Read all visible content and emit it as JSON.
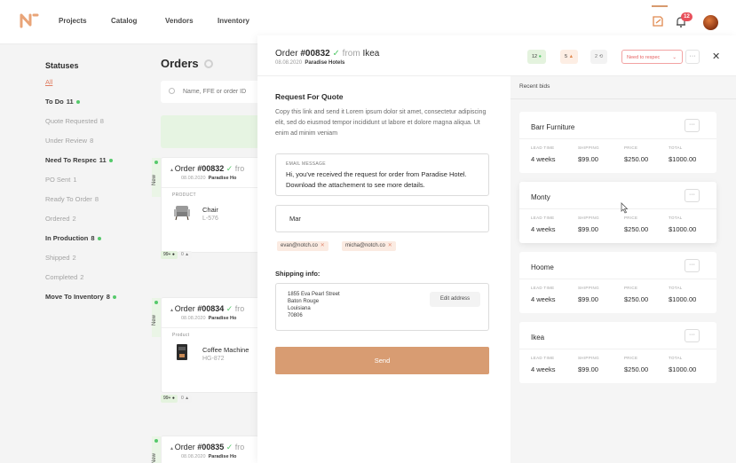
{
  "nav": {
    "items": [
      "Projects",
      "Catalog",
      "Vendors",
      "Inventory"
    ],
    "notification_count": "12"
  },
  "sidebar": {
    "title": "Statuses",
    "all_label": "All",
    "items": [
      {
        "label": "To Do",
        "count": "11",
        "style": "dark",
        "dot": true
      },
      {
        "label": "Quote Requested",
        "count": "8",
        "style": "muted",
        "dot": false
      },
      {
        "label": "Under Review",
        "count": "8",
        "style": "muted",
        "dot": false
      },
      {
        "label": "Need To Respec",
        "count": "11",
        "style": "dark",
        "dot": true
      },
      {
        "label": "PO Sent",
        "count": "1",
        "style": "muted",
        "dot": false
      },
      {
        "label": "Ready To Order",
        "count": "8",
        "style": "muted",
        "dot": false
      },
      {
        "label": "Ordered",
        "count": "2",
        "style": "muted",
        "dot": false
      },
      {
        "label": "In Production",
        "count": "8",
        "style": "dark",
        "dot": true
      },
      {
        "label": "Shipped",
        "count": "2",
        "style": "muted",
        "dot": false
      },
      {
        "label": "Completed",
        "count": "2",
        "style": "muted",
        "dot": false
      },
      {
        "label": "Move To Inventory",
        "count": "8",
        "style": "dark",
        "dot": true
      }
    ]
  },
  "orders": {
    "title": "Orders",
    "search_placeholder": "Name, FFE or order ID",
    "cards": [
      {
        "prefix": "Order ",
        "number": "#00832",
        "from": " fro",
        "date": "08.08.2020",
        "hotel": "Paradise Ho",
        "label": "PRODUCT",
        "name": "Chair",
        "code": "L-576",
        "badge1": "99+",
        "badge2": "0"
      },
      {
        "prefix": "Order ",
        "number": "#00834",
        "from": " fro",
        "date": "08.08.2020",
        "hotel": "Paradise Ho",
        "label": "Product",
        "name": "Coffee Machine",
        "code": "HG-872",
        "badge1": "99+",
        "badge2": "0"
      },
      {
        "prefix": "Order ",
        "number": "#00835",
        "from": " fro",
        "date": "08.08.2020",
        "hotel": "Paradise Ho"
      }
    ],
    "new_label": "New"
  },
  "modal": {
    "title_prefix": "Order ",
    "number": "#00832",
    "from": " from ",
    "vendor": "Ikea",
    "date": "08.08.2020",
    "hotel": "Paradise Hotels",
    "chips": {
      "messages": "12",
      "orders": "5",
      "history": "2",
      "status": "Need to respec"
    },
    "rfq_title": "Request For Quote",
    "rfq_desc": "Copy this link and send it Lorem ipsum dolor sit amet, consectetur adipiscing elit, sed do eiusmod tempor incididunt ut labore et dolore magna aliqua. Ut enim ad minim veniam",
    "email_label": "EMAIL MESSAGE",
    "email_text": "Hi, you've received the request for order from Paradise Hotel. Download the attachement to see more details.",
    "to_value": "Mar",
    "recipients": [
      "evan@notch.co",
      "micha@notch.co"
    ],
    "shipping_title": "Shipping info:",
    "address": [
      "1855 Eva Pearl Street",
      "Baton Rouge",
      "Louisiana",
      "70806"
    ],
    "edit_address": "Edit address",
    "send": "Send"
  },
  "bids": {
    "title": "Recent bids",
    "columns": [
      "LEAD TIME",
      "SHIPPING",
      "PRICE",
      "TOTAL"
    ],
    "items": [
      {
        "vendor": "Barr Furniture",
        "lead": "4 weeks",
        "shipping": "$99.00",
        "price": "$250.00",
        "total": "$1000.00"
      },
      {
        "vendor": "Monty",
        "lead": "4 weeks",
        "shipping": "$99.00",
        "price": "$250.00",
        "total": "$1000.00"
      },
      {
        "vendor": "Hoome",
        "lead": "4 weeks",
        "shipping": "$99.00",
        "price": "$250.00",
        "total": "$1000.00"
      },
      {
        "vendor": "Ikea",
        "lead": "4 weeks",
        "shipping": "$99.00",
        "price": "$250.00",
        "total": "$1000.00"
      }
    ]
  },
  "colors": {
    "accent": "#d89c72",
    "success": "#55c96b",
    "danger": "#e66262"
  }
}
